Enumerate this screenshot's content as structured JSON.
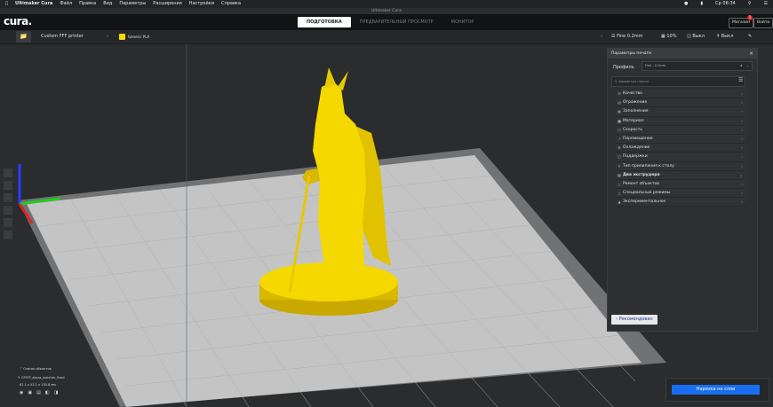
{
  "mac_menu": {
    "app": "Ultimaker Cura",
    "items": [
      "Файл",
      "Правка",
      "Вид",
      "Параметры",
      "Расширения",
      "Настройки",
      "Справка"
    ],
    "time": "Ср 08:34"
  },
  "window_title": "Ultimaker Cura",
  "topbar": {
    "logo": "cura.",
    "stages": [
      "ПОДГОТОВКА",
      "ПРЕДВАРИТЕЛЬНЫЙ ПРОСМОТР",
      "МОНИТОР"
    ],
    "active_stage": 0,
    "marketplace": "Магазин",
    "signin": "Войти",
    "badge": "1"
  },
  "toolbar": {
    "printer": "Custom FFF printer",
    "material": "Generic PLA",
    "profile": "Fine 0.2mm",
    "infill": "10%",
    "support": "Выкл",
    "adhesion": "Выкл"
  },
  "panel": {
    "title": "Параметры печати",
    "profile_label": "Профиль",
    "profile_value": "Fine - 0.2mm",
    "search_placeholder": "параметры поиска",
    "categories": [
      {
        "label": "Качество",
        "expanded": false
      },
      {
        "label": "Отражение",
        "expanded": false
      },
      {
        "label": "Заполнение",
        "expanded": false
      },
      {
        "label": "Материал",
        "expanded": false
      },
      {
        "label": "Скорость",
        "expanded": false
      },
      {
        "label": "Перемещение",
        "expanded": false
      },
      {
        "label": "Охлаждение",
        "expanded": false
      },
      {
        "label": "Поддержки",
        "expanded": false
      },
      {
        "label": "Тип прилипания к столу",
        "expanded": false
      },
      {
        "label": "Два экструдера",
        "expanded": true
      },
      {
        "label": "Ремонт объектов",
        "expanded": false
      },
      {
        "label": "Специальные режимы",
        "expanded": false
      },
      {
        "label": "Экспериментальное",
        "expanded": false
      }
    ],
    "recommended_btn": "Рекомендован"
  },
  "objects": {
    "list_label": "Список объектов",
    "file_name": "CFFFP_abyss_watcher_fixed",
    "dimensions": "62.1 x 52.1 x 130.8 мм"
  },
  "slice_button": "Нарезка на слои",
  "colors": {
    "model": "#f5d800",
    "plate": "#c4c4c4",
    "accent": "#196ef0"
  }
}
